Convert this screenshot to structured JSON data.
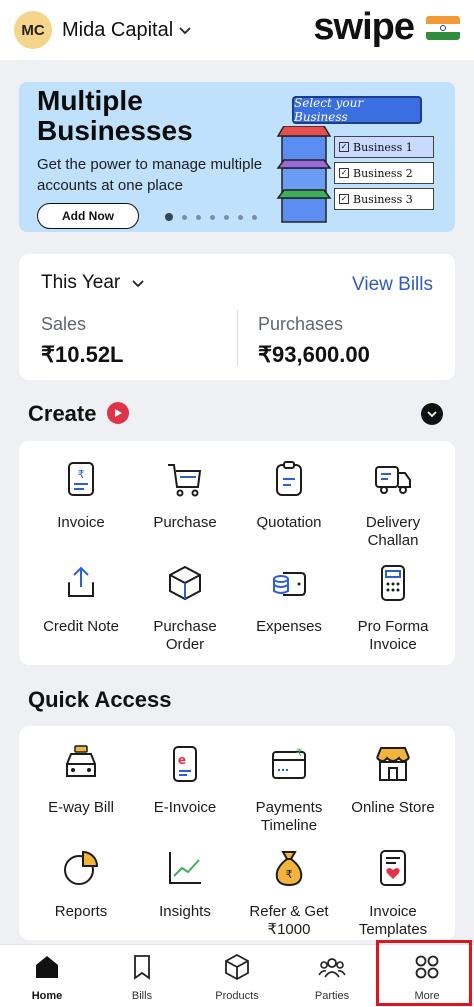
{
  "header": {
    "avatar_initials": "MC",
    "company_name": "Mida Capital",
    "brand": "swipe"
  },
  "banner": {
    "title": "Multiple Businesses",
    "subtitle": "Get the power to manage multiple accounts at one place",
    "button": "Add Now",
    "illustration": {
      "select_label": "Select your Business",
      "businesses": [
        "Business 1",
        "Business 2",
        "Business 3"
      ]
    },
    "dot_count": 7,
    "active_dot": 1
  },
  "stats": {
    "period": "This Year",
    "view_bills": "View Bills",
    "sales_label": "Sales",
    "sales_value": "₹10.52L",
    "purchases_label": "Purchases",
    "purchases_value": "₹93,600.00"
  },
  "create": {
    "title": "Create",
    "items": [
      {
        "label": "Invoice",
        "icon": "invoice-icon"
      },
      {
        "label": "Purchase",
        "icon": "cart-icon"
      },
      {
        "label": "Quotation",
        "icon": "clipboard-icon"
      },
      {
        "label": "Delivery Challan",
        "icon": "truck-icon"
      },
      {
        "label": "Credit Note",
        "icon": "upload-icon"
      },
      {
        "label": "Purchase Order",
        "icon": "box-icon"
      },
      {
        "label": "Expenses",
        "icon": "wallet-icon"
      },
      {
        "label": "Pro Forma Invoice",
        "icon": "calculator-icon"
      }
    ]
  },
  "quick_access": {
    "title": "Quick Access",
    "items": [
      {
        "label": "E-way Bill",
        "icon": "car-icon"
      },
      {
        "label": "E-Invoice",
        "icon": "e-invoice-icon"
      },
      {
        "label": "Payments Timeline",
        "icon": "payment-card-icon"
      },
      {
        "label": "Online Store",
        "icon": "store-icon"
      },
      {
        "label": "Reports",
        "icon": "pie-chart-icon"
      },
      {
        "label": "Insights",
        "icon": "line-chart-icon"
      },
      {
        "label": "Refer & Get ₹1000",
        "icon": "money-bag-icon"
      },
      {
        "label": "Invoice Templates",
        "icon": "template-icon"
      }
    ]
  },
  "bottom_nav": {
    "items": [
      {
        "label": "Home",
        "icon": "home-icon",
        "active": true
      },
      {
        "label": "Bills",
        "icon": "bookmark-icon",
        "active": false
      },
      {
        "label": "Products",
        "icon": "cube-icon",
        "active": false
      },
      {
        "label": "Parties",
        "icon": "users-icon",
        "active": false
      },
      {
        "label": "More",
        "icon": "grid-icon",
        "active": false
      }
    ]
  },
  "colors": {
    "accent": "#2f5bc4",
    "banner_bg": "#bfe1fb",
    "icon_blue": "#2b5fd9",
    "highlight_red": "#e0141b"
  }
}
